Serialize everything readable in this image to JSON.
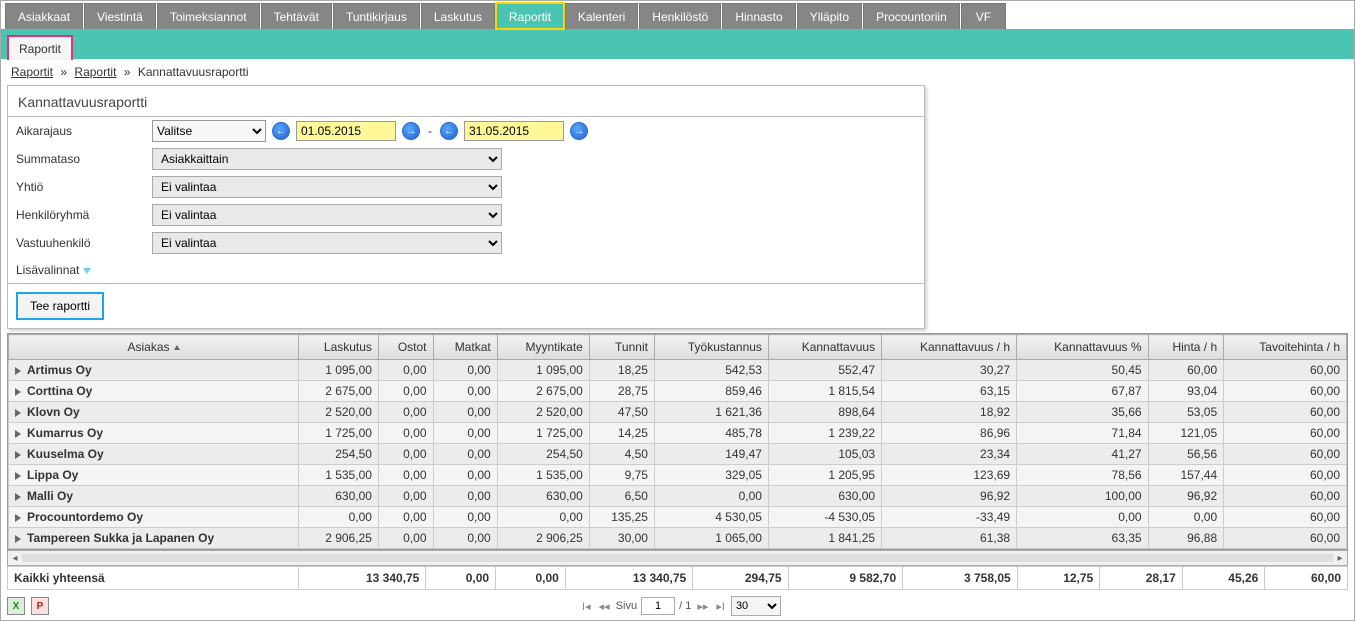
{
  "nav": {
    "tabs": [
      "Asiakkaat",
      "Viestintä",
      "Toimeksiannot",
      "Tehtävät",
      "Tuntikirjaus",
      "Laskutus",
      "Raportit",
      "Kalenteri",
      "Henkilöstö",
      "Hinnasto",
      "Ylläpito",
      "Procountoriin",
      "VF"
    ],
    "active_index": 6,
    "subtab": "Raportit"
  },
  "crumbs": {
    "a": "Raportit",
    "b": "Raportit",
    "c": "Kannattavuusraportti",
    "sep": "»"
  },
  "panel": {
    "title": "Kannattavuusraportti",
    "rows": {
      "aikarajaus_label": "Aikarajaus",
      "aikarajaus_value": "Valitse",
      "date_from": "01.05.2015",
      "date_to": "31.05.2015",
      "summataso_label": "Summataso",
      "summataso_value": "Asiakkaittain",
      "yhtio_label": "Yhtiö",
      "yhtio_value": "Ei valintaa",
      "henkiloryhma_label": "Henkilöryhmä",
      "henkiloryhma_value": "Ei valintaa",
      "vastuu_label": "Vastuuhenkilö",
      "vastuu_value": "Ei valintaa"
    },
    "lisavalinnat": "Lisävalinnat",
    "run": "Tee raportti"
  },
  "grid": {
    "headers": [
      "Asiakas",
      "Laskutus",
      "Ostot",
      "Matkat",
      "Myyntikate",
      "Tunnit",
      "Työkustannus",
      "Kannattavuus",
      "Kannattavuus / h",
      "Kannattavuus %",
      "Hinta / h",
      "Tavoitehinta / h"
    ],
    "rows": [
      {
        "name": "Artimus Oy",
        "vals": [
          "1 095,00",
          "0,00",
          "0,00",
          "1 095,00",
          "18,25",
          "542,53",
          "552,47",
          "30,27",
          "50,45",
          "60,00",
          "60,00"
        ]
      },
      {
        "name": "Corttina Oy",
        "vals": [
          "2 675,00",
          "0,00",
          "0,00",
          "2 675,00",
          "28,75",
          "859,46",
          "1 815,54",
          "63,15",
          "67,87",
          "93,04",
          "60,00"
        ]
      },
      {
        "name": "Klovn Oy",
        "vals": [
          "2 520,00",
          "0,00",
          "0,00",
          "2 520,00",
          "47,50",
          "1 621,36",
          "898,64",
          "18,92",
          "35,66",
          "53,05",
          "60,00"
        ]
      },
      {
        "name": "Kumarrus Oy",
        "vals": [
          "1 725,00",
          "0,00",
          "0,00",
          "1 725,00",
          "14,25",
          "485,78",
          "1 239,22",
          "86,96",
          "71,84",
          "121,05",
          "60,00"
        ]
      },
      {
        "name": "Kuuselma Oy",
        "vals": [
          "254,50",
          "0,00",
          "0,00",
          "254,50",
          "4,50",
          "149,47",
          "105,03",
          "23,34",
          "41,27",
          "56,56",
          "60,00"
        ]
      },
      {
        "name": "Lippa Oy",
        "vals": [
          "1 535,00",
          "0,00",
          "0,00",
          "1 535,00",
          "9,75",
          "329,05",
          "1 205,95",
          "123,69",
          "78,56",
          "157,44",
          "60,00"
        ]
      },
      {
        "name": "Malli Oy",
        "vals": [
          "630,00",
          "0,00",
          "0,00",
          "630,00",
          "6,50",
          "0,00",
          "630,00",
          "96,92",
          "100,00",
          "96,92",
          "60,00"
        ]
      },
      {
        "name": "Procountordemo Oy",
        "vals": [
          "0,00",
          "0,00",
          "0,00",
          "0,00",
          "135,25",
          "4 530,05",
          "-4 530,05",
          "-33,49",
          "0,00",
          "0,00",
          "60,00"
        ]
      },
      {
        "name": "Tampereen Sukka ja Lapanen Oy",
        "vals": [
          "2 906,25",
          "0,00",
          "0,00",
          "2 906,25",
          "30,00",
          "1 065,00",
          "1 841,25",
          "61,38",
          "63,35",
          "96,88",
          "60,00"
        ]
      }
    ],
    "total_label": "Kaikki yhteensä",
    "totals": [
      "13 340,75",
      "0,00",
      "0,00",
      "13 340,75",
      "294,75",
      "9 582,70",
      "3 758,05",
      "12,75",
      "28,17",
      "45,26",
      "60,00"
    ]
  },
  "pager": {
    "page_label": "Sivu",
    "page": "1",
    "of": "/ 1",
    "size": "30"
  }
}
